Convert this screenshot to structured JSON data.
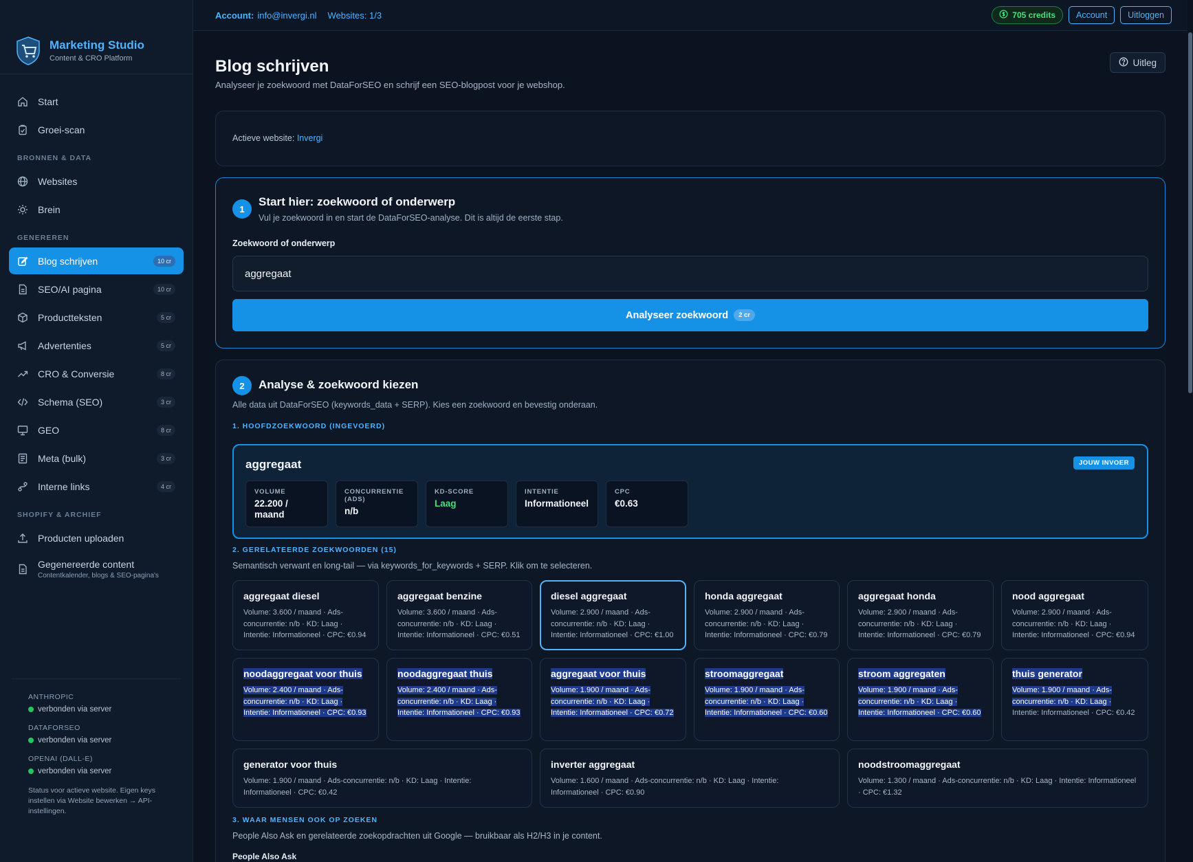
{
  "brand": {
    "name": "Marketing Studio",
    "subtitle": "Content & CRO Platform"
  },
  "nav": {
    "start": "Start",
    "groeiscan": "Groei-scan",
    "section_bronnen": "BRONNEN & DATA",
    "websites": "Websites",
    "brein": "Brein",
    "section_genereren": "GENEREREN",
    "items": [
      {
        "label": "Blog schrijven",
        "badge": "10 cr"
      },
      {
        "label": "SEO/AI pagina",
        "badge": "10 cr"
      },
      {
        "label": "Productteksten",
        "badge": "5 cr"
      },
      {
        "label": "Advertenties",
        "badge": "5 cr"
      },
      {
        "label": "CRO & Conversie",
        "badge": "8 cr"
      },
      {
        "label": "Schema (SEO)",
        "badge": "3 cr"
      },
      {
        "label": "GEO",
        "badge": "8 cr"
      },
      {
        "label": "Meta (bulk)",
        "badge": "3 cr"
      },
      {
        "label": "Interne links",
        "badge": "4 cr"
      }
    ],
    "section_shopify": "SHOPIFY & ARCHIEF",
    "producten_uploaden": "Producten uploaden",
    "gegenereerde": "Gegenereerde content",
    "gegenereerde_sub": "Contentkalender, blogs & SEO-pagina's"
  },
  "status": {
    "anthropic": "ANTHROPIC",
    "dataforseo": "DATAFORSEO",
    "openai": "OPENAI (DALL-E)",
    "connected": "verbonden via server",
    "note": "Status voor actieve website. Eigen keys instellen via Website bewerken → API-instellingen."
  },
  "topbar": {
    "account_label": "Account:",
    "account_value": "info@invergi.nl",
    "websites": "Websites: 1/3",
    "credits": "705 credits",
    "account_btn": "Account",
    "logout_btn": "Uitloggen"
  },
  "page": {
    "title": "Blog schrijven",
    "subtitle": "Analyseer je zoekwoord met DataForSEO en schrijf een SEO-blogpost voor je webshop.",
    "help": "Uitleg",
    "active_site_label": "Actieve website:",
    "active_site_value": "Invergi"
  },
  "step1": {
    "num": "1",
    "title": "Start hier: zoekwoord of onderwerp",
    "subtitle": "Vul je zoekwoord in en start de DataForSEO-analyse. Dit is altijd de eerste stap.",
    "field_label": "Zoekwoord of onderwerp",
    "input_value": "aggregaat",
    "button": "Analyseer zoekwoord",
    "button_cost": "2 cr"
  },
  "step2": {
    "num": "2",
    "title": "Analyse & zoekwoord kiezen",
    "subtitle": "Alle data uit DataForSEO (keywords_data + SERP). Kies een zoekwoord en bevestig onderaan.",
    "section1": "1. HOOFDZOEKWOORD (INGEVOERD)",
    "main_keyword": "aggregaat",
    "main_tag": "JOUW INVOER",
    "metrics": [
      {
        "label": "VOLUME",
        "value": "22.200 / maand"
      },
      {
        "label": "CONCURRENTIE (ADS)",
        "value": "n/b"
      },
      {
        "label": "KD-SCORE",
        "value": "Laag"
      },
      {
        "label": "INTENTIE",
        "value": "Informationeel"
      },
      {
        "label": "CPC",
        "value": "€0.63"
      }
    ],
    "section2": "2. GERELATEERDE ZOEKWOORDEN (15)",
    "section2_sub": "Semantisch verwant en long-tail — via keywords_for_keywords + SERP. Klik om te selecteren.",
    "related": [
      {
        "kw": "aggregaat diesel",
        "desc": "Volume: 3.600 / maand · Ads-concurrentie: n/b · KD: Laag · Intentie: Informationeel · CPC: €0.94"
      },
      {
        "kw": "aggregaat benzine",
        "desc": "Volume: 3.600 / maand · Ads-concurrentie: n/b · KD: Laag · Intentie: Informationeel · CPC: €0.51"
      },
      {
        "kw": "diesel aggregaat",
        "desc": "Volume: 2.900 / maand · Ads-concurrentie: n/b · KD: Laag · Intentie: Informationeel · CPC: €1.00"
      },
      {
        "kw": "honda aggregaat",
        "desc": "Volume: 2.900 / maand · Ads-concurrentie: n/b · KD: Laag · Intentie: Informationeel · CPC: €0.79"
      },
      {
        "kw": "aggregaat honda",
        "desc": "Volume: 2.900 / maand · Ads-concurrentie: n/b · KD: Laag · Intentie: Informationeel · CPC: €0.79"
      },
      {
        "kw": "nood aggregaat",
        "desc": "Volume: 2.900 / maand · Ads-concurrentie: n/b · KD: Laag · Intentie: Informationeel · CPC: €0.94"
      },
      {
        "kw": "noodaggregaat voor thuis",
        "desc": "Volume: 2.400 / maand · Ads-concurrentie: n/b · KD: Laag · Intentie: Informationeel · CPC: €0.93"
      },
      {
        "kw": "noodaggregaat thuis",
        "desc": "Volume: 2.400 / maand · Ads-concurrentie: n/b · KD: Laag · Intentie: Informationeel · CPC: €0.93"
      },
      {
        "kw": "aggregaat voor thuis",
        "desc": "Volume: 1.900 / maand · Ads-concurrentie: n/b · KD: Laag · Intentie: Informationeel · CPC: €0.72"
      },
      {
        "kw": "stroomaggregaat",
        "desc": "Volume: 1.900 / maand · Ads-concurrentie: n/b · KD: Laag · Intentie: Informationeel · CPC: €0.60"
      },
      {
        "kw": "stroom aggregaten",
        "desc": "Volume: 1.900 / maand · Ads-concurrentie: n/b · KD: Laag · Intentie: Informationeel · CPC: €0.60"
      },
      {
        "kw": "thuis generator",
        "desc_hl": "Volume: 1.900 / maand · Ads-concurrentie: n/b · KD: Laag ·",
        "desc_rest": "Intentie: Informationeel · CPC: €0.42"
      },
      {
        "kw": "generator voor thuis",
        "desc": "Volume: 1.900 / maand · Ads-concurrentie: n/b · KD: Laag · Intentie: Informationeel · CPC: €0.42"
      },
      {
        "kw": "inverter aggregaat",
        "desc": "Volume: 1.600 / maand · Ads-concurrentie: n/b · KD: Laag · Intentie: Informationeel · CPC: €0.90"
      },
      {
        "kw": "noodstroomaggregaat",
        "desc": "Volume: 1.300 / maand · Ads-concurrentie: n/b · KD: Laag · Intentie: Informationeel · CPC: €1.32"
      }
    ],
    "section3": "3. WAAR MENSEN OOK OP ZOEKEN",
    "section3_sub": "People Also Ask en gerelateerde zoekopdrachten uit Google — bruikbaar als H2/H3 in je content.",
    "paa_label": "People Also Ask"
  }
}
